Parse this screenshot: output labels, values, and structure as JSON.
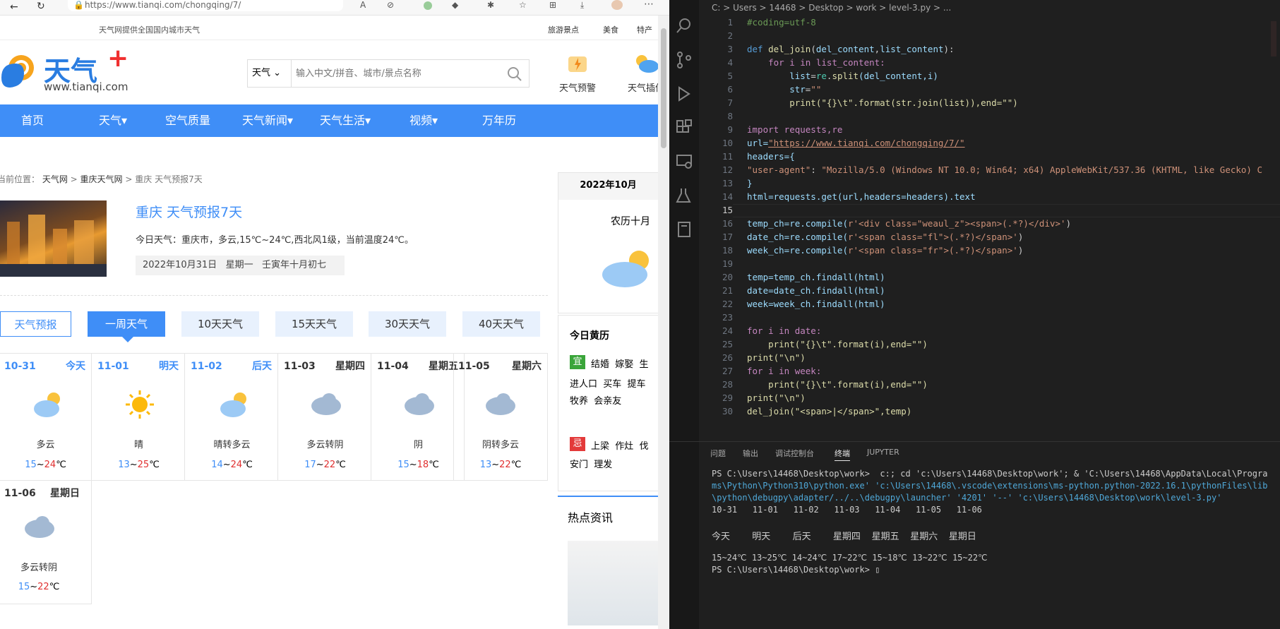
{
  "browser": {
    "url": "https://www.tianqi.com/chongqing/7/",
    "topbar_text": "天气网提供全国国内城市天气",
    "top_links": [
      "旅游景点",
      "美食",
      "特产"
    ],
    "logo_text": "天气",
    "logo_plus": "+",
    "logo_domain": "www.tianqi.com",
    "search_select": "天气",
    "search_placeholder": "输入中文/拼音、城市/景点名称",
    "icon_warning_label": "天气预警",
    "icon_radar_label": "天气插件",
    "nav": [
      "首页",
      "天气▾",
      "空气质量",
      "天气新闻▾",
      "天气生活▾",
      "视频▾",
      "万年历"
    ],
    "breadcrumb_prefix": "当前位置：",
    "breadcrumb": [
      "天气网",
      "重庆天气网",
      "重庆 天气预报7天"
    ],
    "page_title": "重庆 天气预报7天",
    "today_desc": "今日天气：重庆市，多云,15℃~24℃,西北风1级，当前温度24℃。",
    "date_line": "2022年10月31日   星期一   壬寅年十月初七",
    "tabs": [
      "天气预报",
      "一周天气",
      "10天天气",
      "15天天气",
      "30天天气",
      "40天天气"
    ],
    "days": [
      {
        "date": "10-31",
        "week": "今天",
        "cond": "多云",
        "lo": "15",
        "hi": "24",
        "icon": "partly-cloudy-icon"
      },
      {
        "date": "11-01",
        "week": "明天",
        "cond": "晴",
        "lo": "13",
        "hi": "25",
        "icon": "sunny-icon"
      },
      {
        "date": "11-02",
        "week": "后天",
        "cond": "晴转多云",
        "lo": "14",
        "hi": "24",
        "icon": "partly-cloudy-icon"
      },
      {
        "date": "11-03",
        "week": "星期四",
        "cond": "多云转阴",
        "lo": "17",
        "hi": "22",
        "icon": "cloudy-icon"
      },
      {
        "date": "11-04",
        "week": "星期五",
        "cond": "阴",
        "lo": "15",
        "hi": "18",
        "icon": "cloudy-icon"
      },
      {
        "date": "11-05",
        "week": "星期六",
        "cond": "阴转多云",
        "lo": "13",
        "hi": "22",
        "icon": "cloudy-icon"
      },
      {
        "date": "11-06",
        "week": "星期日",
        "cond": "多云转阴",
        "lo": "15",
        "hi": "22",
        "icon": "cloudy-icon"
      }
    ],
    "unit": "℃",
    "tilde": "~",
    "side_date": "2022年10月",
    "side_lunar": "农历十月",
    "almanac_title": "今日黄历",
    "yi_badge": "宜",
    "yi_items": "结婚  嫁娶  生",
    "yi_items2": "进人口  买车  提车",
    "yi_items3": "牧养  会亲友",
    "ji_badge": "忌",
    "ji_items": "上梁  作灶  伐",
    "ji_items2": "安门  理发",
    "hot_title": "热点资讯"
  },
  "vscode": {
    "breadcrumb": "C: > Users > 14468 > Desktop > work > level-3.py > ...",
    "panel_tabs": [
      "问题",
      "输出",
      "调试控制台",
      "终端",
      "JUPYTER"
    ],
    "active_panel_tab": "终端",
    "terminal_lines": [
      "PS C:\\Users\\14468\\Desktop\\work>  c:; cd 'c:\\Users\\14468\\Desktop\\work'; & 'C:\\Users\\14468\\AppData\\Local\\Progra",
      "ms\\Python\\Python310\\python.exe' 'c:\\Users\\14468\\.vscode\\extensions\\ms-python.python-2022.16.1\\pythonFiles\\lib",
      "\\python\\debugpy\\adapter/../..\\debugpy\\launcher' '4201' '--' 'c:\\Users\\14468\\Desktop\\work\\level-3.py'",
      "10-31   11-01   11-02   11-03   11-04   11-05   11-06",
      "",
      "今天    明天    后天    星期四  星期五  星期六  星期日",
      "",
      "15~24℃ 13~25℃ 14~24℃ 17~22℃ 15~18℃ 13~22℃ 15~22℃",
      "PS C:\\Users\\14468\\Desktop\\work> ▯"
    ],
    "code_lines": [
      "1",
      "2",
      "3",
      "4",
      "5",
      "6",
      "7",
      "8",
      "9",
      "10",
      "11",
      "12",
      "13",
      "14",
      "15",
      "16",
      "17",
      "18",
      "19",
      "20",
      "21",
      "22",
      "23",
      "24",
      "25",
      "26",
      "27",
      "28",
      "29",
      "30"
    ],
    "code": {
      "l1": "#coding=utf-8",
      "l3a": "def ",
      "l3b": "del_join",
      "l3c": "(",
      "l3d": "del_content",
      "l3e": ",",
      "l3f": "list_content",
      "l3g": "):",
      "l4": "    for i in list_content:",
      "l5a": "        list",
      "l5b": "=",
      "l5c": "re",
      "l5d": ".",
      "l5e": "split",
      "l5f": "(del_content,i)",
      "l6a": "        str",
      "l6b": "=",
      "l6c": "\"\"",
      "l7": "        print(\"{}\\t\".format(str.join(list)),end=\"\")",
      "l9": "import requests,re",
      "l10a": "url=",
      "l10b": "\"https://www.tianqi.com/chongqing/7/\"",
      "l11": "headers={",
      "l12a": "\"user-agent\"",
      "l12b": ": ",
      "l12c": "\"Mozilla/5.0 (Windows NT 10.0; Win64; x64) AppleWebKit/537.36 (KHTML, like Gecko) C",
      "l13": "}",
      "l14": "html=requests.get(url,headers=headers).text",
      "l16a": "temp_ch=re.compile(",
      "l16b": "r'<div class=\"weaul_z\"><span>(.*?)</div>'",
      "l16c": ")",
      "l17a": "date_ch=re.compile(",
      "l17b": "r'<span class=\"fl\">(.*?)</span>'",
      "l17c": ")",
      "l18a": "week_ch=re.compile(",
      "l18b": "r'<span class=\"fr\">(.*?)</span>'",
      "l18c": ")",
      "l20": "temp=temp_ch.findall(html)",
      "l21": "date=date_ch.findall(html)",
      "l22": "week=week_ch.findall(html)",
      "l24": "for i in date:",
      "l25": "    print(\"{}\\t\".format(i),end=\"\")",
      "l26": "print(\"\\n\")",
      "l27": "for i in week:",
      "l28": "    print(\"{}\\t\".format(i),end=\"\")",
      "l29": "print(\"\\n\")",
      "l30": "del_join(\"<span>|</span>\",temp)"
    }
  },
  "colors": {
    "accent": "#3f8ef7",
    "editor_bg": "#1f1f1f",
    "keyword": "#c586c0",
    "function": "#dcdcaa",
    "string": "#ce9178"
  }
}
